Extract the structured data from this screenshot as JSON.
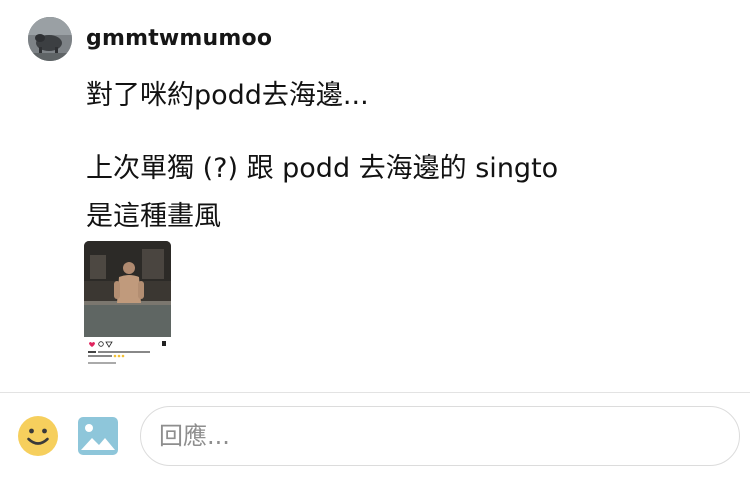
{
  "post": {
    "username": "gmmtwmumoo",
    "lines": [
      "對了咪約podd去海邊...",
      "上次單獨 (?) 跟 podd 去海邊的 singto",
      "是這種畫風"
    ]
  },
  "attachment": {
    "icons": [
      "heart-icon",
      "comment-icon",
      "share-icon",
      "bookmark-icon"
    ]
  },
  "reply_bar": {
    "emoji_icon": "smiley-icon",
    "image_icon": "image-icon",
    "input_placeholder": "回應..."
  },
  "colors": {
    "emoji_yellow": "#f6cf5d",
    "image_icon_blue": "#8ec6da",
    "input_border": "#dcdcdc",
    "divider": "#e3e3e3"
  }
}
